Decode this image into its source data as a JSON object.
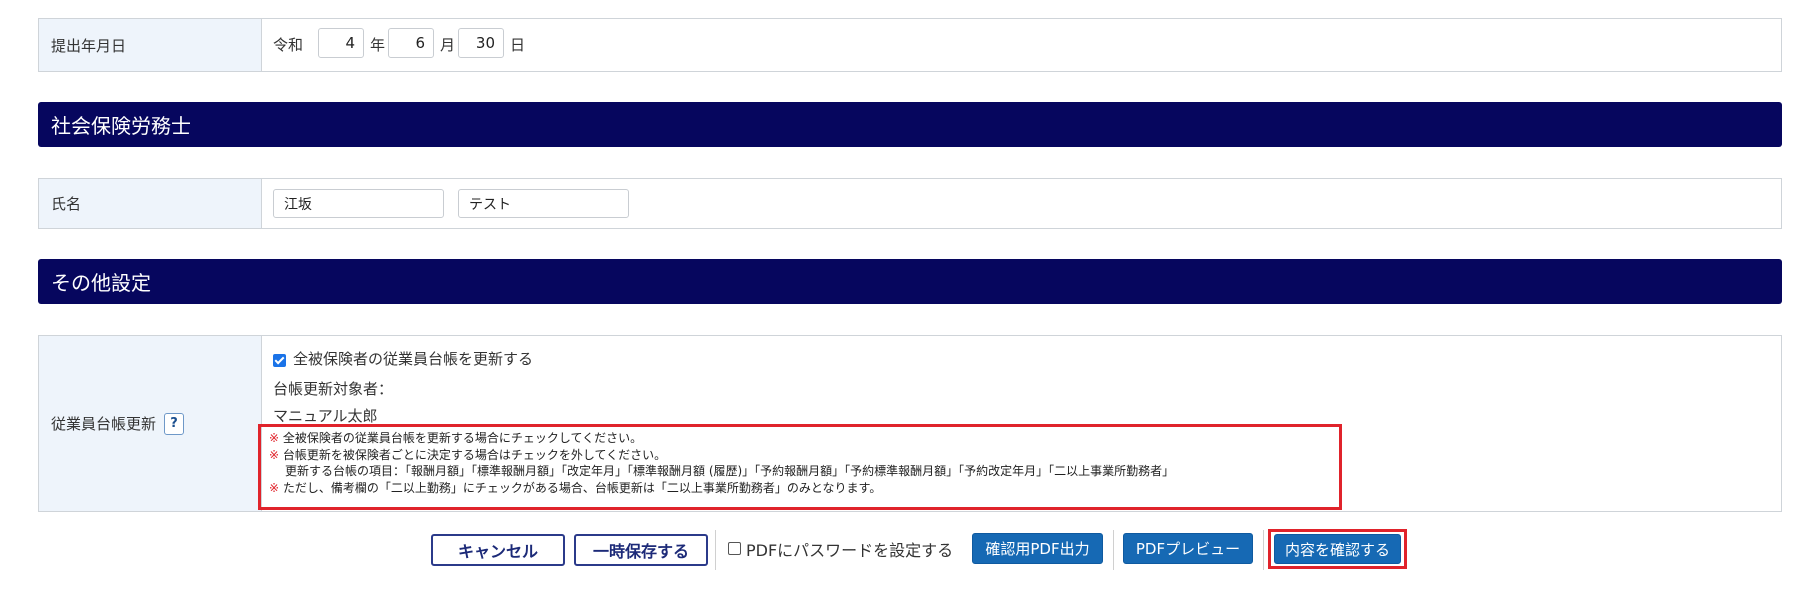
{
  "submission": {
    "label": "提出年月日",
    "era": "令和",
    "year": "4",
    "year_unit": "年",
    "month": "6",
    "month_unit": "月",
    "day": "30",
    "day_unit": "日"
  },
  "section_sharoushi": {
    "title": "社会保険労務士",
    "name_label": "氏名",
    "last_name": "江坂",
    "first_name": "テスト"
  },
  "section_other": {
    "title": "その他設定",
    "ledger_label": "従業員台帳更新",
    "help_label": "?",
    "checkbox_label": "全被保険者の従業員台帳を更新する",
    "checkbox_checked": true,
    "target_label": "台帳更新対象者：",
    "target_person": "マニュアル太郎",
    "notes": {
      "mark": "※",
      "line1": "全被保険者の従業員台帳を更新する場合にチェックしてください。",
      "line2": "台帳更新を被保険者ごとに決定する場合はチェックを外してください。",
      "line3": "更新する台帳の項目：「報酬月額」「標準報酬月額」「改定年月」「標準報酬月額 (履歴)」「予約報酬月額」「予約標準報酬月額」「予約改定年月」「二以上事業所勤務者」",
      "line4": "ただし、備考欄の「二以上勤務」にチェックがある場合、台帳更新は「二以上事業所勤務者」のみとなります。"
    }
  },
  "actions": {
    "cancel": "キャンセル",
    "save_temp": "一時保存する",
    "pdf_password": "PDFにパスワードを設定する",
    "pdf_password_checked": false,
    "confirm_pdf": "確認用PDF出力",
    "pdf_preview": "PDFプレビュー",
    "confirm": "内容を確認する"
  },
  "colors": {
    "header_bg": "#06065e",
    "label_bg": "#eef4fb",
    "primary_button": "#1669b4",
    "highlight": "#e0232b"
  }
}
